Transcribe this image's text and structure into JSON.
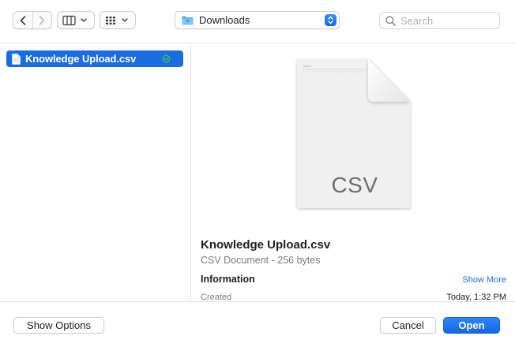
{
  "toolbar": {
    "location": "Downloads",
    "search_placeholder": "Search"
  },
  "file_list": {
    "items": [
      {
        "name": "Knowledge Upload.csv",
        "selected": true
      }
    ]
  },
  "preview": {
    "icon_label": "CSV",
    "title": "Knowledge Upload.csv",
    "kind": "CSV Document - 256 bytes",
    "info_heading": "Information",
    "show_more": "Show More",
    "created_label": "Created",
    "created_value": "Today, 1:32 PM"
  },
  "buttons": {
    "show_options": "Show Options",
    "cancel": "Cancel",
    "open": "Open"
  },
  "colors": {
    "accent": "#1b6ce1",
    "sync_badge": "#34c759"
  }
}
